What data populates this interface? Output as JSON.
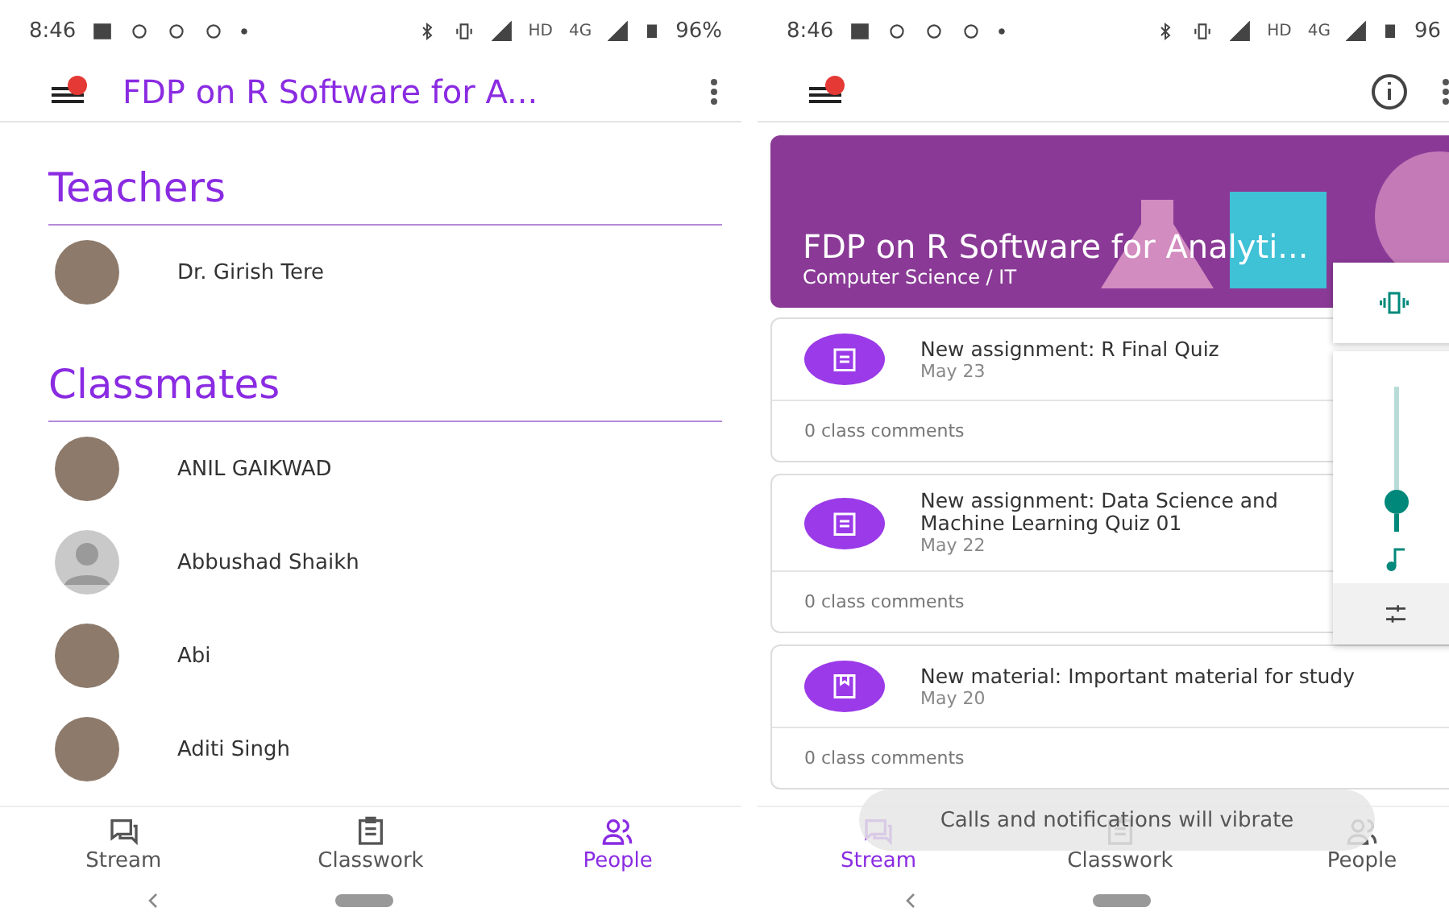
{
  "left_screen": {
    "status_bar": {
      "time": "8:46",
      "battery": "96%",
      "network_labels": [
        "HD",
        "4G"
      ]
    },
    "app_bar": {
      "title": "FDP on R Software for A..."
    },
    "sections": [
      {
        "heading": "Teachers",
        "people": [
          {
            "name": "Dr. Girish Tere",
            "kind": "photo"
          }
        ]
      },
      {
        "heading": "Classmates",
        "people": [
          {
            "name": "ANIL GAIKWAD",
            "kind": "photo"
          },
          {
            "name": "Abbushad Shaikh",
            "kind": "default"
          },
          {
            "name": "Abi",
            "kind": "photo"
          },
          {
            "name": "Aditi Singh",
            "kind": "photo"
          }
        ]
      }
    ],
    "bottom_nav": [
      {
        "label": "Stream",
        "kind": "stream",
        "selected": false
      },
      {
        "label": "Classwork",
        "kind": "classwork",
        "selected": false
      },
      {
        "label": "People",
        "kind": "people",
        "selected": true
      }
    ]
  },
  "right_screen": {
    "status_bar": {
      "time": "8:46",
      "battery": "96",
      "network_labels": [
        "HD",
        "4G"
      ]
    },
    "banner": {
      "title": "FDP on R Software for Analyti...",
      "subtitle": "Computer Science / IT"
    },
    "posts": [
      {
        "kind": "assignment",
        "title": "New assignment: R Final Quiz",
        "date": "May 23",
        "comments": "0 class comments"
      },
      {
        "kind": "assignment",
        "title": "New assignment: Data Science and Machine Learning Quiz 01",
        "date": "May 22",
        "comments": "0 class comments"
      },
      {
        "kind": "material",
        "title": "New material: Important material for study",
        "date": "May 20",
        "comments": "0 class comments"
      }
    ],
    "volume_panel": {
      "level": 0.15
    },
    "toast": "Calls and notifications will vibrate",
    "bottom_nav": [
      {
        "label": "Stream",
        "kind": "stream",
        "selected": true
      },
      {
        "label": "Classwork",
        "kind": "classwork",
        "selected": false
      },
      {
        "label": "People",
        "kind": "people",
        "selected": false
      }
    ]
  }
}
